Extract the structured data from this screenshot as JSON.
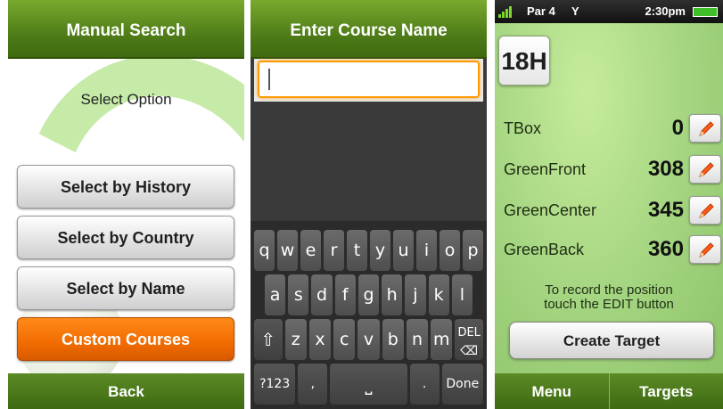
{
  "manual_search": {
    "title": "Manual Search",
    "prompt": "Select Option",
    "options": [
      {
        "label": "Select by History"
      },
      {
        "label": "Select by Country"
      },
      {
        "label": "Select by Name"
      },
      {
        "label": "Custom Courses"
      }
    ],
    "back_label": "Back",
    "accent": "#f16b00"
  },
  "course_entry": {
    "title": "Enter Course Name",
    "input_value": "",
    "keyboard": {
      "row1": [
        "q",
        "w",
        "e",
        "r",
        "t",
        "y",
        "u",
        "i",
        "o",
        "p"
      ],
      "row2": [
        "a",
        "s",
        "d",
        "f",
        "g",
        "h",
        "j",
        "k",
        "l"
      ],
      "row3_shift": "⇧",
      "row3": [
        "z",
        "x",
        "c",
        "v",
        "b",
        "n",
        "m"
      ],
      "row3_del": "DEL",
      "row4_symbols": "?123",
      "row4_comma": ",",
      "row4_space": "⎵",
      "row4_period": ".",
      "row4_done": "Done"
    }
  },
  "hole_view": {
    "status": {
      "carrier": "Par 4",
      "network": "Y",
      "time": "2:30pm"
    },
    "hole": "18H",
    "distances": [
      {
        "label": "TBox",
        "value": 0
      },
      {
        "label": "GreenFront",
        "value": 308
      },
      {
        "label": "GreenCenter",
        "value": 345
      },
      {
        "label": "GreenBack",
        "value": 360
      }
    ],
    "hint_line1": "To record the position",
    "hint_line2": "touch the EDIT button",
    "create_label": "Create Target",
    "tabs": [
      {
        "label": "Menu"
      },
      {
        "label": "Targets"
      }
    ],
    "colors": {
      "brand_green": "#4f7d18",
      "edit_orange": "#ff5a1a"
    }
  }
}
